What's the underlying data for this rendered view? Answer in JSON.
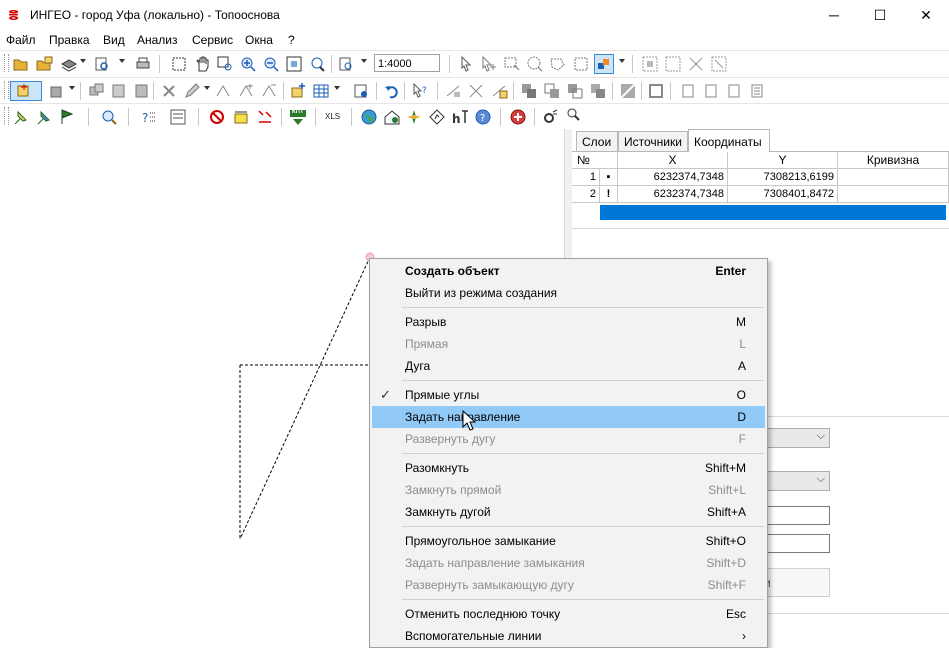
{
  "window": {
    "title": "ИНГЕО - город Уфа (локально) - Топооснова",
    "minimize": "─",
    "maximize": "☐",
    "close": "✕"
  },
  "menu": [
    "Файл",
    "Правка",
    "Вид",
    "Анализ",
    "Сервис",
    "Окна",
    "?"
  ],
  "toolbar": {
    "scale": "1:4000",
    "xls_label": "XLS",
    "knp_label": "КПТ"
  },
  "panel": {
    "tabs": [
      "Слои",
      "Источники",
      "Координаты"
    ],
    "active_tab": "Координаты",
    "columns": [
      "№",
      "X",
      "Y",
      "Кривизна"
    ],
    "rows": [
      {
        "n": "1",
        "mark": "▪",
        "x": "6232374,7348",
        "y": "7308213,6199",
        "curv": ""
      },
      {
        "n": "2",
        "mark": "!",
        "x": "6232374,7348",
        "y": "7308401,8472",
        "curv": ""
      }
    ],
    "partial_button_text": "и"
  },
  "context_menu": {
    "groups": [
      [
        {
          "label": "Создать объект",
          "key": "Enter",
          "bold": true
        },
        {
          "label": "Выйти из режима создания",
          "key": ""
        }
      ],
      [
        {
          "label": "Разрыв",
          "key": "M"
        },
        {
          "label": "Прямая",
          "key": "L",
          "disabled": true
        },
        {
          "label": "Дуга",
          "key": "A"
        }
      ],
      [
        {
          "label": "Прямые углы",
          "key": "O",
          "checked": true
        },
        {
          "label": "Задать направление",
          "key": "D",
          "hover": true
        },
        {
          "label": "Развернуть дугу",
          "key": "F",
          "disabled": true
        }
      ],
      [
        {
          "label": "Разомкнуть",
          "key": "Shift+M"
        },
        {
          "label": "Замкнуть прямой",
          "key": "Shift+L",
          "disabled": true
        },
        {
          "label": "Замкнуть дугой",
          "key": "Shift+A"
        }
      ],
      [
        {
          "label": "Прямоугольное замыкание",
          "key": "Shift+O"
        },
        {
          "label": "Задать направление замыкания",
          "key": "Shift+D",
          "disabled": true
        },
        {
          "label": "Развернуть замыкающую дугу",
          "key": "Shift+F",
          "disabled": true
        }
      ],
      [
        {
          "label": "Отменить последнюю точку",
          "key": "Esc"
        },
        {
          "label": "Вспомогательные линии",
          "key": "›"
        }
      ]
    ]
  },
  "colors": {
    "selection": "#0078d7",
    "menu_hover": "#91c9f7",
    "menu_bg": "#f2f2f2",
    "disabled_text": "#8d8d8d",
    "app_icon": "#d40000"
  }
}
